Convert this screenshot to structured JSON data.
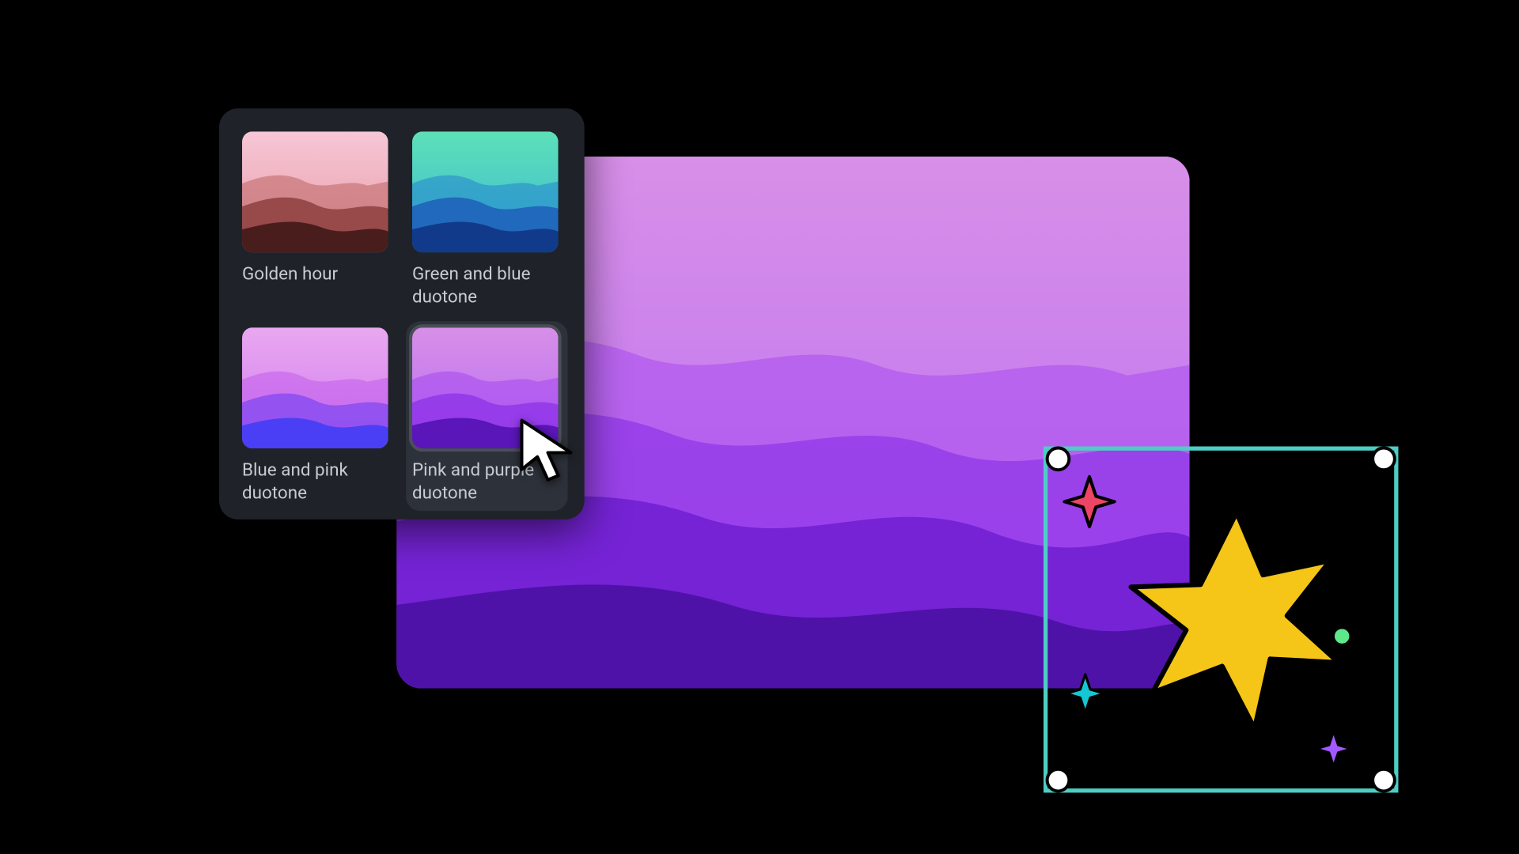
{
  "filters": {
    "options": [
      {
        "id": "golden-hour",
        "label": "Golden hour",
        "selected": false
      },
      {
        "id": "green-blue-duotone",
        "label": "Green and blue duotone",
        "selected": false
      },
      {
        "id": "blue-pink-duotone",
        "label": "Blue and pink duotone",
        "selected": false
      },
      {
        "id": "pink-purple-duotone",
        "label": "Pink and purple duotone",
        "selected": true
      }
    ]
  },
  "canvas": {
    "applied_filter": "Pink and purple duotone"
  },
  "selection": {
    "active": true,
    "handle_color": "#4ecdc4",
    "rotation_handle_color": "#5de88a",
    "shapes": [
      {
        "name": "star-main",
        "fill": "#f5c518"
      },
      {
        "name": "sparkle-red",
        "fill": "#ee4466"
      },
      {
        "name": "sparkle-cyan",
        "fill": "#15c7d4"
      },
      {
        "name": "sparkle-purple",
        "fill": "#a259ff"
      }
    ]
  }
}
